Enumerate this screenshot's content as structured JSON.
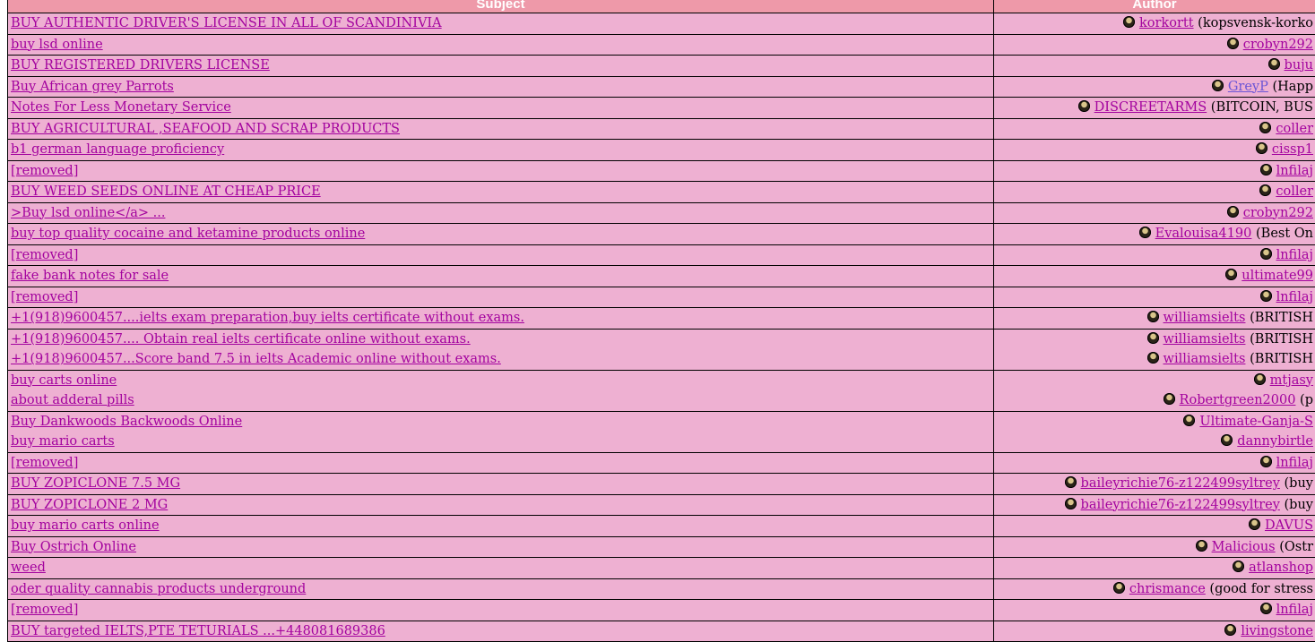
{
  "header": {
    "subject": "Subject",
    "author": "Author"
  },
  "colors": {
    "row_bg": "#eeb0d2",
    "header_bg": "#ee99a9",
    "link": "#a3029e",
    "link_alt": "#6b55d6"
  },
  "groups": [
    [
      {
        "subject": "BUY AUTHENTIC DRIVER'S LICENSE IN ALL OF SCANDINIVIA",
        "author": "korkortt",
        "note": "(kopsvensk-korko"
      }
    ],
    [
      {
        "subject": "buy lsd online",
        "author": "crobyn292",
        "note": ""
      }
    ],
    [
      {
        "subject": "BUY REGISTERED DRIVERS LICENSE",
        "author": "buju",
        "note": ""
      }
    ],
    [
      {
        "subject": "Buy African grey Parrots",
        "author": "GreyP",
        "note": "(Happ",
        "alt": true
      }
    ],
    [
      {
        "subject": "Notes For Less Monetary Service",
        "author": "DISCREETARMS",
        "note": "(BITCOIN, BUS"
      }
    ],
    [
      {
        "subject": "BUY AGRICULTURAL ,SEAFOOD AND SCRAP PRODUCTS",
        "author": "coller",
        "note": ""
      }
    ],
    [
      {
        "subject": "b1 german language proficiency",
        "author": "cissp1",
        "note": ""
      }
    ],
    [
      {
        "subject": "[removed]",
        "author": "lnfilaj",
        "note": ""
      }
    ],
    [
      {
        "subject": "BUY WEED SEEDS ONLINE AT CHEAP PRICE",
        "author": "coller",
        "note": ""
      }
    ],
    [
      {
        "subject": ">Buy lsd online</a> ...",
        "author": "crobyn292",
        "note": ""
      }
    ],
    [
      {
        "subject": "buy top quality cocaine and ketamine products online",
        "author": "Evalouisa4190",
        "note": "(Best On"
      }
    ],
    [
      {
        "subject": "[removed]",
        "author": "lnfilaj",
        "note": ""
      }
    ],
    [
      {
        "subject": "fake bank notes for sale",
        "author": "ultimate99",
        "note": ""
      }
    ],
    [
      {
        "subject": "[removed]",
        "author": "lnfilaj",
        "note": ""
      }
    ],
    [
      {
        "subject": "+1(918)9600457....ielts exam preparation,buy ielts certificate without exams.",
        "author": "williamsielts",
        "note": "(BRITISH"
      }
    ],
    [
      {
        "subject": "+1(918)9600457.... Obtain real ielts certificate online without exams.",
        "author": "williamsielts",
        "note": "(BRITISH"
      },
      {
        "subject": "+1(918)9600457...Score band 7.5 in ielts Academic online without exams.",
        "author": "williamsielts",
        "note": "(BRITISH"
      }
    ],
    [
      {
        "subject": "buy carts online",
        "author": "mtjasy",
        "note": ""
      },
      {
        "subject": "about adderal pills",
        "author": "Robertgreen2000",
        "note": "(p"
      }
    ],
    [
      {
        "subject": "Buy Dankwoods Backwoods Online",
        "author": "Ultimate-Ganja-S",
        "note": ""
      },
      {
        "subject": "buy mario carts",
        "author": "dannybirtle",
        "note": ""
      }
    ],
    [
      {
        "subject": "[removed]",
        "author": "lnfilaj",
        "note": ""
      }
    ],
    [
      {
        "subject": "BUY ZOPICLONE 7.5 MG",
        "author": "baileyrichie76-z122499syltrey",
        "note": "(buy"
      }
    ],
    [
      {
        "subject": "BUY ZOPICLONE 2 MG",
        "author": "baileyrichie76-z122499syltrey",
        "note": "(buy"
      }
    ],
    [
      {
        "subject": "buy mario carts online",
        "author": "DAVUS",
        "note": ""
      }
    ],
    [
      {
        "subject": "Buy Ostrich Online",
        "author": "Malicious",
        "note": "(Ostr"
      }
    ],
    [
      {
        "subject": "weed",
        "author": "atlanshop",
        "note": ""
      }
    ],
    [
      {
        "subject": "oder quality cannabis products underground",
        "author": "chrismance",
        "note": "(good for stress"
      }
    ],
    [
      {
        "subject": "[removed]",
        "author": "lnfilaj",
        "note": ""
      }
    ],
    [
      {
        "subject": "BUY targeted IELTS,PTE TETURIALS ...+448081689386",
        "author": "livingstone",
        "note": ""
      }
    ]
  ]
}
